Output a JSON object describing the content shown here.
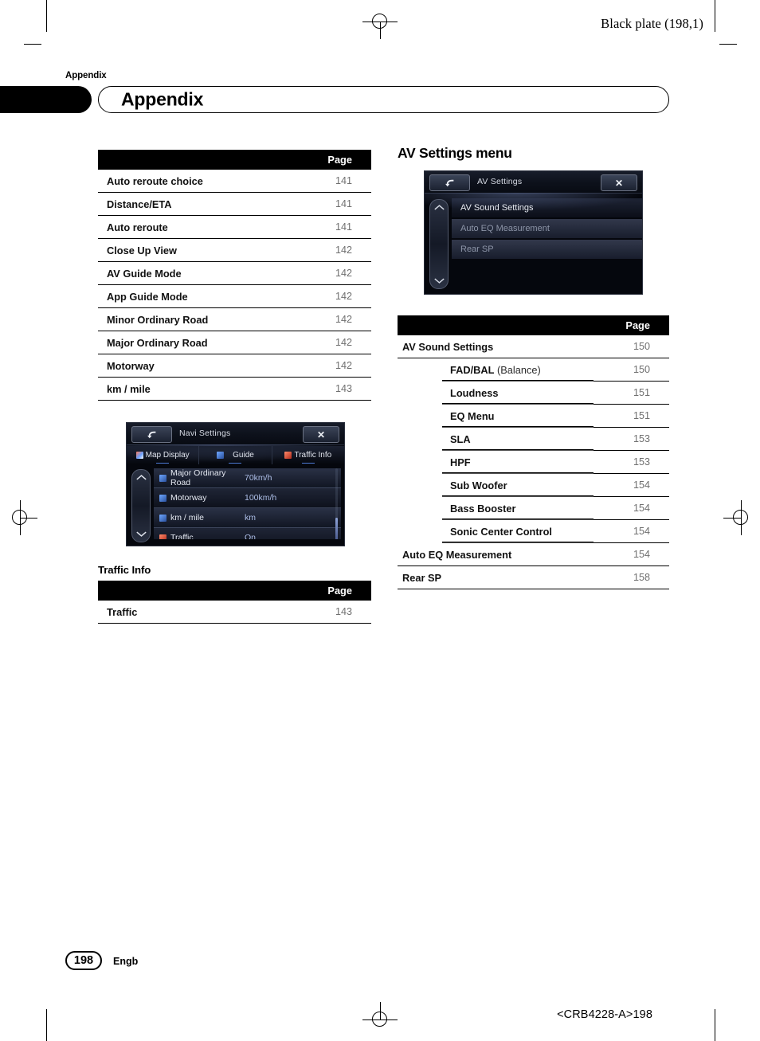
{
  "print_marks": {
    "black_plate": "Black plate (198,1)",
    "doc_id": "<CRB4228-A>198"
  },
  "header": {
    "running_head": "Appendix",
    "chapter_title": "Appendix"
  },
  "footer": {
    "page_number": "198",
    "language": "Engb"
  },
  "left_column": {
    "nav_table": {
      "header": {
        "label": "",
        "page": "Page"
      },
      "rows": [
        {
          "label": "Auto reroute choice",
          "page": "141"
        },
        {
          "label": "Distance/ETA",
          "page": "141"
        },
        {
          "label": "Auto reroute",
          "page": "141"
        },
        {
          "label": "Close Up View",
          "page": "142"
        },
        {
          "label": "AV Guide Mode",
          "page": "142"
        },
        {
          "label": "App Guide Mode",
          "page": "142"
        },
        {
          "label": "Minor Ordinary Road",
          "page": "142"
        },
        {
          "label": "Major Ordinary Road",
          "page": "142"
        },
        {
          "label": "Motorway",
          "page": "142"
        },
        {
          "label": "km / mile",
          "page": "143"
        }
      ]
    },
    "navi_screenshot": {
      "title": "Navi Settings",
      "back_icon": "back-arrow-icon",
      "close_label": "✕",
      "tabs": [
        {
          "label": "Map Display",
          "icon": "map-display-icon"
        },
        {
          "label": "Guide",
          "icon": "guide-icon"
        },
        {
          "label": "Traffic Info",
          "icon": "traffic-info-icon"
        }
      ],
      "rows": [
        {
          "name": "Major Ordinary Road",
          "value": "70km/h",
          "icon": "guide-icon"
        },
        {
          "name": "Motorway",
          "value": "100km/h",
          "icon": "guide-icon"
        },
        {
          "name": "km / mile",
          "value": "km",
          "icon": "guide-icon"
        },
        {
          "name": "Traffic",
          "value": "On",
          "icon": "traffic-info-icon"
        }
      ],
      "scroll_up_icon": "chevron-up-icon",
      "scroll_down_icon": "chevron-down-icon"
    },
    "traffic_info": {
      "title": "Traffic Info",
      "table": {
        "header": {
          "label": "",
          "page": "Page"
        },
        "rows": [
          {
            "label": "Traffic",
            "page": "143"
          }
        ]
      }
    }
  },
  "right_column": {
    "section_title": "AV Settings menu",
    "av_screenshot": {
      "title": "AV Settings",
      "back_icon": "back-arrow-icon",
      "close_label": "✕",
      "rows": [
        {
          "label": "AV Sound Settings"
        },
        {
          "label": "Auto EQ Measurement"
        },
        {
          "label": "Rear SP"
        }
      ],
      "scroll_up_icon": "chevron-up-icon",
      "scroll_down_icon": "chevron-down-icon"
    },
    "av_table": {
      "header": {
        "label": "",
        "page": "Page"
      },
      "rows": [
        {
          "label": "AV Sound Settings",
          "page": "150",
          "level": 1
        },
        {
          "label": "FAD/BAL",
          "suffix": " (Balance)",
          "page": "150",
          "level": 2
        },
        {
          "label": "Loudness",
          "page": "151",
          "level": 2
        },
        {
          "label": "EQ Menu",
          "page": "151",
          "level": 2
        },
        {
          "label": "SLA",
          "page": "153",
          "level": 2
        },
        {
          "label": "HPF",
          "page": "153",
          "level": 2
        },
        {
          "label": "Sub Woofer",
          "page": "154",
          "level": 2
        },
        {
          "label": "Bass Booster",
          "page": "154",
          "level": 2
        },
        {
          "label": "Sonic Center Control",
          "page": "154",
          "level": 2
        },
        {
          "label": "Auto EQ Measurement",
          "page": "154",
          "level": 1
        },
        {
          "label": "Rear SP",
          "page": "158",
          "level": 1
        }
      ]
    }
  },
  "colors": {
    "table_header_bg": "#000000",
    "page_number_color": "#6f6f6f",
    "screen_bg": "#05070d",
    "screen_accent": "#4e7bd6"
  }
}
